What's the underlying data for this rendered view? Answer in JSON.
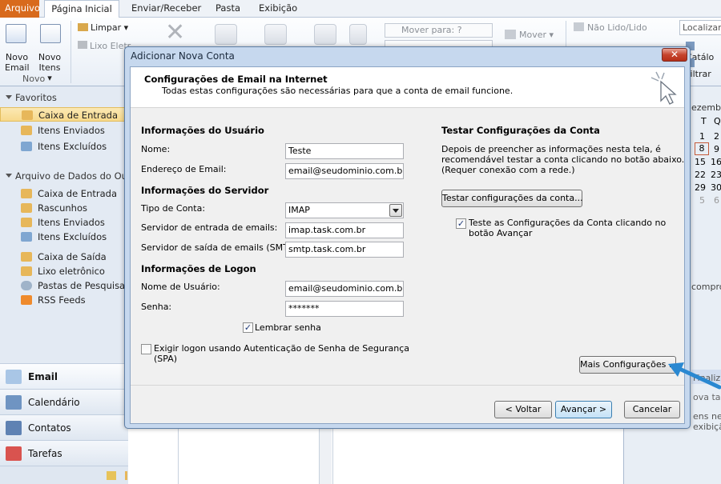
{
  "ribbon": {
    "tabs": [
      "Arquivo",
      "Página Inicial",
      "Enviar/Receber",
      "Pasta",
      "Exibição"
    ],
    "new_email": [
      "Novo",
      "Email"
    ],
    "new_items": [
      "Novo",
      "Itens ▾"
    ],
    "group_novo": "Novo",
    "clean": "Limpar ▾",
    "junk": "Lixo Eletr...",
    "move_to": "Mover para: ?",
    "move": "Mover ▾",
    "unread": "Não Lido/Lido",
    "find": "Localizar",
    "catalog": "Catálo",
    "filter": "Filtrar"
  },
  "nav": {
    "favorites_header": "Favoritos",
    "favorites": [
      "Caixa de Entrada",
      "Itens Enviados",
      "Itens Excluídos"
    ],
    "data_file_header": "Arquivo de Dados do Outlook",
    "data_items": [
      "Caixa de Entrada",
      "Rascunhos",
      "Itens Enviados",
      "Itens Excluídos",
      "Caixa de Saída",
      "Lixo eletrônico",
      "Pastas de Pesquisa",
      "RSS Feeds"
    ],
    "bottom": [
      "Email",
      "Calendário",
      "Contatos",
      "Tarefas"
    ]
  },
  "calendar": {
    "month_partial": "ezembr",
    "day_headers": [
      "T",
      "Q"
    ],
    "rows": [
      [
        "1",
        "2"
      ],
      [
        "8",
        "9"
      ],
      [
        "15",
        "16"
      ],
      [
        "22",
        "23"
      ],
      [
        "29",
        "30"
      ],
      [
        "5",
        "6"
      ]
    ]
  },
  "right_pane": {
    "compro": "compro",
    "finaliz": "Finaliz",
    "nova_tare": "ova tare",
    "itens_nes": "ens nes",
    "exibicao": "exibiçã"
  },
  "dialog": {
    "title": "Adicionar Nova Conta",
    "close": "✕",
    "header_title": "Configurações de Email na Internet",
    "header_sub": "Todas estas configurações são necessárias para que a conta de email funcione.",
    "user_info": "Informações do Usuário",
    "name_label": "Nome:",
    "name_value": "Teste",
    "email_label": "Endereço de Email:",
    "email_value": "email@seudominio.com.br",
    "server_info": "Informações do Servidor",
    "account_type_label": "Tipo de Conta:",
    "account_type_value": "IMAP",
    "incoming_label": "Servidor de entrada de emails:",
    "incoming_value": "imap.task.com.br",
    "outgoing_label": "Servidor de saída de emails (SMTP):",
    "outgoing_value": "smtp.task.com.br",
    "logon_info": "Informações de Logon",
    "username_label": "Nome de Usuário:",
    "username_value": "email@seudominio.com.br",
    "password_label": "Senha:",
    "password_value": "*******",
    "remember_password": "Lembrar senha",
    "spa_line1": "Exigir logon usando Autenticação de Senha de Segurança",
    "spa_line2": "(SPA)",
    "test_header": "Testar Configurações da Conta",
    "test_desc1": "Depois de preencher as informações nesta tela, é",
    "test_desc2": "recomendável testar a conta clicando no botão abaixo.",
    "test_desc3": "(Requer conexão com a rede.)",
    "test_button": "Testar configurações da conta...",
    "test_next_line1": "Teste as Configurações da Conta clicando no",
    "test_next_line2": "botão Avançar",
    "more_settings": "Mais Configurações ...",
    "back": "< Voltar",
    "next": "Avançar >",
    "cancel": "Cancelar"
  },
  "colors": {
    "file_tab": "#d86a1c",
    "arrow": "#2a88d1",
    "selection": "#f7d98b"
  }
}
